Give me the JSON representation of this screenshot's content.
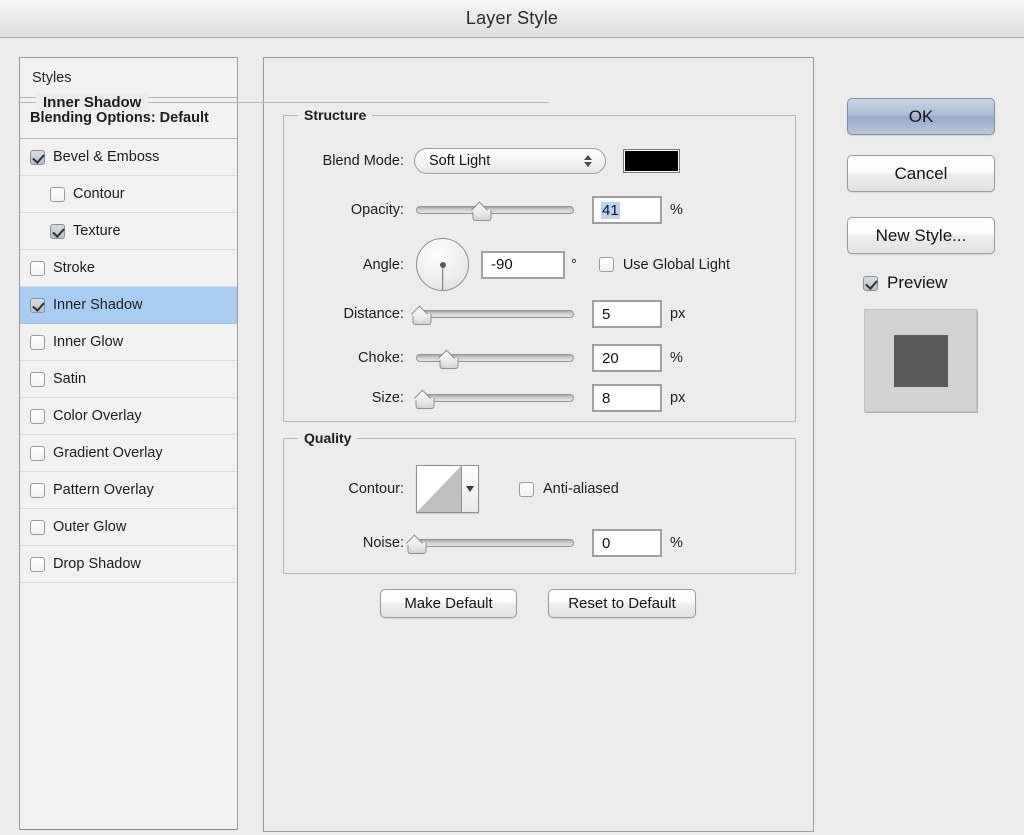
{
  "window": {
    "title": "Layer Style"
  },
  "sidebar": {
    "header": "Styles",
    "blending_options": "Blending Options: Default",
    "effects": [
      {
        "label": "Bevel & Emboss",
        "checked": true,
        "indent": false,
        "selected": false
      },
      {
        "label": "Contour",
        "checked": false,
        "indent": true,
        "selected": false
      },
      {
        "label": "Texture",
        "checked": true,
        "indent": true,
        "selected": false
      },
      {
        "label": "Stroke",
        "checked": false,
        "indent": false,
        "selected": false
      },
      {
        "label": "Inner Shadow",
        "checked": true,
        "indent": false,
        "selected": true
      },
      {
        "label": "Inner Glow",
        "checked": false,
        "indent": false,
        "selected": false
      },
      {
        "label": "Satin",
        "checked": false,
        "indent": false,
        "selected": false
      },
      {
        "label": "Color Overlay",
        "checked": false,
        "indent": false,
        "selected": false
      },
      {
        "label": "Gradient Overlay",
        "checked": false,
        "indent": false,
        "selected": false
      },
      {
        "label": "Pattern Overlay",
        "checked": false,
        "indent": false,
        "selected": false
      },
      {
        "label": "Outer Glow",
        "checked": false,
        "indent": false,
        "selected": false
      },
      {
        "label": "Drop Shadow",
        "checked": false,
        "indent": false,
        "selected": false
      }
    ]
  },
  "panel": {
    "title": "Inner Shadow",
    "structure": {
      "legend": "Structure",
      "blend_mode": {
        "label": "Blend Mode:",
        "value": "Soft Light",
        "color_hex": "#000000"
      },
      "opacity": {
        "label": "Opacity:",
        "value": "41",
        "unit": "%",
        "slider_pct": 41,
        "selected": true
      },
      "angle": {
        "label": "Angle:",
        "value": "-90",
        "unit": "°",
        "degrees": -90,
        "use_global_light": {
          "label": "Use Global Light",
          "checked": false
        }
      },
      "distance": {
        "label": "Distance:",
        "value": "5",
        "unit": "px",
        "slider_pct": 3
      },
      "choke": {
        "label": "Choke:",
        "value": "20",
        "unit": "%",
        "slider_pct": 20
      },
      "size": {
        "label": "Size:",
        "value": "8",
        "unit": "px",
        "slider_pct": 5
      }
    },
    "quality": {
      "legend": "Quality",
      "contour": {
        "label": "Contour:",
        "shape": "linear-contour-icon"
      },
      "anti_aliased": {
        "label": "Anti-aliased",
        "checked": false
      },
      "noise": {
        "label": "Noise:",
        "value": "0",
        "unit": "%",
        "slider_pct": 0
      }
    },
    "make_default": "Make Default",
    "reset_to_default": "Reset to Default"
  },
  "actions": {
    "ok": "OK",
    "cancel": "Cancel",
    "new_style": "New Style...",
    "preview": {
      "label": "Preview",
      "checked": true
    }
  },
  "colors": {
    "selection_blue": "#a9cdf0",
    "field_selection": "#b8d4f1",
    "swatch_black": "#000000",
    "preview_square": "#595959"
  }
}
